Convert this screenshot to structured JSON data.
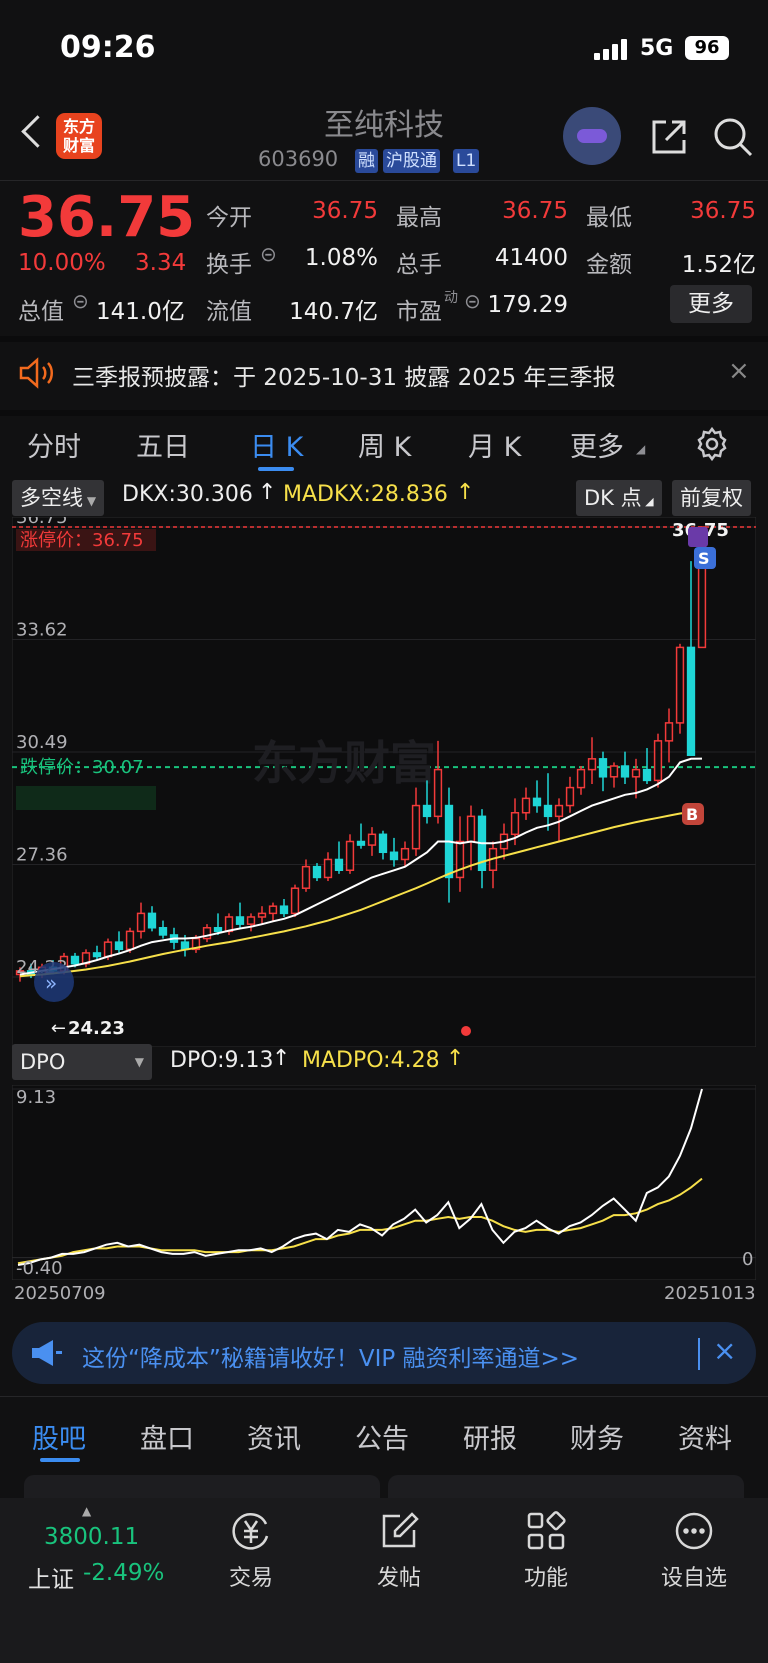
{
  "status": {
    "time": "09:26",
    "network": "5G",
    "battery": "96"
  },
  "header": {
    "logo_text": "东方财富",
    "stock_name": "至纯科技",
    "stock_code": "603690",
    "tags": [
      "融",
      "沪股通",
      "L1"
    ]
  },
  "quote": {
    "price": "36.75",
    "change_pct": "10.00%",
    "change": "3.34",
    "fields": [
      {
        "label": "今开",
        "value": "36.75",
        "color": "#f23a3a"
      },
      {
        "label": "最高",
        "value": "36.75",
        "color": "#f23a3a"
      },
      {
        "label": "最低",
        "value": "36.75",
        "color": "#f23a3a"
      },
      {
        "label": "换手",
        "value": "1.08%",
        "color": "#f2f2f2"
      },
      {
        "label": "总手",
        "value": "41400",
        "color": "#f2f2f2"
      },
      {
        "label": "金额",
        "value": "1.52亿",
        "color": "#f2f2f2"
      },
      {
        "label": "总值",
        "value": "141.0亿",
        "color": "#f2f2f2"
      },
      {
        "label": "流值",
        "value": "140.7亿",
        "color": "#f2f2f2"
      },
      {
        "label": "市盈",
        "value": "179.29",
        "color": "#f2f2f2"
      }
    ],
    "pe_superscript": "动",
    "more_label": "更多"
  },
  "notice": {
    "text": "三季报预披露：于 2025-10-31 披露 2025 年三季报",
    "close": "×"
  },
  "period_tabs": [
    "分时",
    "五日",
    "日 K",
    "周 K",
    "月 K",
    "更多"
  ],
  "indicator": {
    "selector": "多空线",
    "dkx": "DKX:30.306",
    "madkx": "MADKX:28.836",
    "dk_btn": "DK 点",
    "adjust_btn": "前复权"
  },
  "chart_data": {
    "type": "candlestick",
    "y_ticks": [
      "36.75",
      "33.62",
      "30.49",
      "27.36",
      "24.23"
    ],
    "ylim": [
      24.23,
      36.75
    ],
    "limit_up_label": "涨停价：36.75",
    "limit_down_label": "跌停价：30.07",
    "limit_up": 36.75,
    "limit_down": 30.07,
    "high_label": "36.75",
    "low_label": "24.23",
    "candles": [
      [
        24.3,
        24.5,
        24.1,
        24.4
      ],
      [
        24.4,
        24.6,
        24.2,
        24.3
      ],
      [
        24.3,
        24.6,
        24.2,
        24.5
      ],
      [
        24.5,
        24.7,
        24.3,
        24.4
      ],
      [
        24.4,
        24.9,
        24.3,
        24.8
      ],
      [
        24.8,
        24.9,
        24.5,
        24.6
      ],
      [
        24.6,
        25.0,
        24.5,
        24.9
      ],
      [
        24.9,
        25.1,
        24.7,
        24.8
      ],
      [
        24.8,
        25.3,
        24.7,
        25.2
      ],
      [
        25.2,
        25.5,
        24.9,
        25.0
      ],
      [
        25.0,
        25.6,
        24.9,
        25.5
      ],
      [
        25.5,
        26.3,
        25.3,
        26.0
      ],
      [
        26.0,
        26.2,
        25.5,
        25.6
      ],
      [
        25.6,
        25.8,
        25.3,
        25.4
      ],
      [
        25.4,
        25.6,
        25.0,
        25.2
      ],
      [
        25.2,
        25.4,
        24.8,
        25.0
      ],
      [
        25.0,
        25.4,
        24.9,
        25.3
      ],
      [
        25.3,
        25.7,
        25.2,
        25.6
      ],
      [
        25.6,
        26.0,
        25.4,
        25.5
      ],
      [
        25.5,
        26.0,
        25.4,
        25.9
      ],
      [
        25.9,
        26.3,
        25.6,
        25.7
      ],
      [
        25.7,
        26.0,
        25.5,
        25.9
      ],
      [
        25.9,
        26.2,
        25.7,
        26.0
      ],
      [
        26.0,
        26.3,
        25.8,
        26.2
      ],
      [
        26.2,
        26.4,
        25.9,
        26.0
      ],
      [
        26.0,
        26.8,
        25.9,
        26.7
      ],
      [
        26.7,
        27.5,
        26.6,
        27.3
      ],
      [
        27.3,
        27.4,
        26.9,
        27.0
      ],
      [
        27.0,
        27.7,
        26.9,
        27.5
      ],
      [
        27.5,
        28.0,
        27.1,
        27.2
      ],
      [
        27.2,
        28.2,
        27.1,
        28.0
      ],
      [
        28.0,
        28.5,
        27.8,
        27.9
      ],
      [
        27.9,
        28.4,
        27.6,
        28.2
      ],
      [
        28.2,
        28.3,
        27.5,
        27.7
      ],
      [
        27.7,
        28.1,
        27.3,
        27.5
      ],
      [
        27.5,
        28.0,
        27.3,
        27.8
      ],
      [
        27.8,
        29.5,
        27.6,
        29.0
      ],
      [
        29.0,
        29.7,
        28.5,
        28.7
      ],
      [
        28.7,
        30.8,
        28.5,
        30.0
      ],
      [
        29.0,
        29.5,
        26.3,
        27.0
      ],
      [
        27.0,
        28.7,
        26.6,
        28.0
      ],
      [
        28.0,
        29.0,
        27.2,
        28.7
      ],
      [
        28.7,
        28.9,
        26.7,
        27.2
      ],
      [
        27.2,
        28.0,
        26.7,
        27.8
      ],
      [
        27.8,
        28.5,
        27.5,
        28.2
      ],
      [
        28.2,
        29.2,
        27.9,
        28.8
      ],
      [
        28.8,
        29.5,
        28.6,
        29.2
      ],
      [
        29.2,
        29.7,
        28.8,
        29.0
      ],
      [
        29.0,
        29.9,
        28.3,
        28.7
      ],
      [
        28.7,
        29.2,
        28.0,
        29.0
      ],
      [
        29.0,
        29.8,
        28.8,
        29.5
      ],
      [
        29.5,
        30.1,
        29.3,
        30.0
      ],
      [
        30.0,
        30.9,
        29.6,
        30.3
      ],
      [
        30.3,
        30.5,
        29.4,
        29.8
      ],
      [
        29.8,
        30.2,
        29.5,
        30.1
      ],
      [
        30.1,
        30.5,
        29.6,
        29.8
      ],
      [
        29.8,
        30.3,
        29.2,
        30.0
      ],
      [
        30.0,
        30.6,
        29.6,
        29.7
      ],
      [
        29.7,
        31.0,
        29.5,
        30.8
      ],
      [
        30.8,
        31.7,
        30.2,
        31.3
      ],
      [
        31.3,
        33.5,
        31.0,
        33.4
      ],
      [
        33.4,
        35.8,
        30.8,
        30.4
      ],
      [
        33.4,
        36.75,
        33.4,
        36.75
      ]
    ],
    "dkx_line": [
      24.3,
      24.35,
      24.4,
      24.45,
      24.5,
      24.55,
      24.62,
      24.7,
      24.8,
      24.88,
      24.98,
      25.1,
      25.2,
      25.25,
      25.3,
      25.3,
      25.32,
      25.38,
      25.45,
      25.52,
      25.58,
      25.63,
      25.7,
      25.78,
      25.85,
      25.95,
      26.1,
      26.25,
      26.4,
      26.55,
      26.7,
      26.85,
      27.0,
      27.1,
      27.2,
      27.3,
      27.5,
      27.7,
      28.0,
      28.0,
      27.95,
      28.0,
      27.95,
      27.95,
      28.0,
      28.1,
      28.25,
      28.38,
      28.45,
      28.55,
      28.7,
      28.85,
      29.0,
      29.1,
      29.2,
      29.3,
      29.35,
      29.45,
      29.6,
      29.8,
      30.2,
      30.3,
      30.306
    ],
    "madkx_line": [
      24.25,
      24.28,
      24.3,
      24.33,
      24.36,
      24.4,
      24.44,
      24.49,
      24.54,
      24.6,
      24.66,
      24.73,
      24.8,
      24.87,
      24.93,
      24.99,
      25.04,
      25.1,
      25.15,
      25.2,
      25.26,
      25.32,
      25.38,
      25.44,
      25.5,
      25.57,
      25.64,
      25.72,
      25.8,
      25.9,
      26.0,
      26.1,
      26.22,
      26.34,
      26.46,
      26.58,
      26.7,
      26.83,
      26.97,
      27.1,
      27.22,
      27.33,
      27.43,
      27.52,
      27.6,
      27.68,
      27.76,
      27.84,
      27.92,
      28.0,
      28.08,
      28.16,
      28.24,
      28.32,
      28.4,
      28.47,
      28.54,
      28.6,
      28.66,
      28.72,
      28.78,
      28.81,
      28.836
    ],
    "dpo": {
      "label": "DPO",
      "dpo_text": "DPO:9.13",
      "madpo_text": "MADPO:4.28",
      "y_ticks": [
        "9.13",
        "-0.40"
      ],
      "zero_label": "0",
      "ylim": [
        -0.4,
        9.13
      ],
      "dpo_line": [
        -0.4,
        -0.3,
        -0.1,
        0.0,
        0.2,
        0.2,
        0.3,
        0.5,
        0.7,
        0.8,
        0.6,
        0.7,
        0.5,
        0.3,
        0.2,
        0.2,
        0.3,
        0.1,
        0.2,
        0.3,
        0.4,
        0.4,
        0.5,
        0.3,
        0.6,
        1.0,
        1.2,
        1.3,
        1.0,
        1.5,
        1.4,
        1.8,
        1.6,
        1.2,
        1.8,
        2.1,
        2.6,
        1.9,
        2.3,
        3.0,
        1.6,
        2.1,
        2.9,
        1.5,
        0.8,
        1.4,
        1.6,
        2.0,
        1.6,
        1.3,
        1.7,
        1.9,
        2.3,
        2.8,
        3.2,
        2.6,
        2.0,
        3.5,
        3.8,
        4.4,
        5.5,
        7.0,
        9.13
      ],
      "madpo_line": [
        -0.3,
        -0.2,
        -0.1,
        0.0,
        0.1,
        0.3,
        0.4,
        0.5,
        0.5,
        0.6,
        0.6,
        0.6,
        0.5,
        0.4,
        0.4,
        0.4,
        0.4,
        0.3,
        0.3,
        0.3,
        0.3,
        0.4,
        0.4,
        0.4,
        0.5,
        0.6,
        0.8,
        1.0,
        1.0,
        1.2,
        1.3,
        1.5,
        1.5,
        1.5,
        1.6,
        1.8,
        2.0,
        2.0,
        2.1,
        2.2,
        2.1,
        2.2,
        2.2,
        2.0,
        1.7,
        1.5,
        1.4,
        1.5,
        1.5,
        1.4,
        1.5,
        1.6,
        1.8,
        2.0,
        2.3,
        2.3,
        2.4,
        2.6,
        2.9,
        3.1,
        3.4,
        3.8,
        4.28
      ],
      "x_start": "20250709",
      "x_end": "20251013"
    }
  },
  "ad": {
    "text": "这份“降成本”秘籍请收好！VIP 融资利率通道>>",
    "close": "×"
  },
  "content_tabs": [
    "股吧",
    "盘口",
    "资讯",
    "公告",
    "研报",
    "财务",
    "资料"
  ],
  "bottom": {
    "index_value": "3800.11",
    "index_name": "上证",
    "index_pct": "-2.49%",
    "nav": [
      {
        "label": "交易",
        "icon": "yen-icon"
      },
      {
        "label": "发帖",
        "icon": "edit-icon"
      },
      {
        "label": "功能",
        "icon": "grid-icon"
      },
      {
        "label": "设自选",
        "icon": "more-icon"
      }
    ]
  },
  "colors": {
    "up": "#f23a3a",
    "down": "#1fd6d6",
    "dkx": "#ffffff",
    "madkx": "#f7e04a",
    "accent": "#3b8cf0"
  }
}
